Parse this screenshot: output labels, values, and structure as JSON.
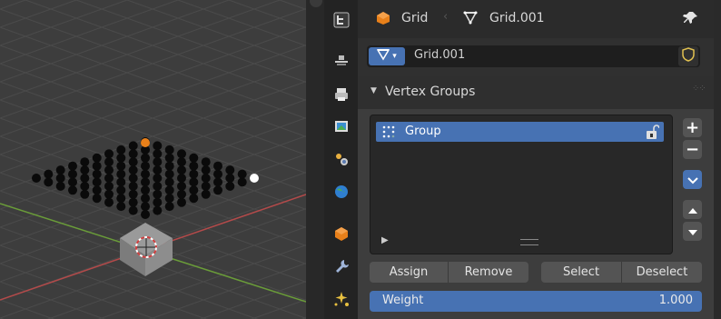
{
  "header": {
    "object_name": "Grid",
    "mesh_name": "Grid.001",
    "pin_icon": "pin-icon"
  },
  "mesh_datablock": {
    "value": "Grid.001",
    "data_icon": "mesh-data-icon",
    "fake_user_icon": "shield-icon"
  },
  "vertex_groups": {
    "title": "Vertex Groups",
    "items": [
      {
        "name": "Group",
        "locked": false
      }
    ],
    "buttons": {
      "assign": "Assign",
      "remove": "Remove",
      "select": "Select",
      "deselect": "Deselect"
    },
    "weight": {
      "label": "Weight",
      "value": "1.000"
    }
  },
  "tabs": [
    {
      "name": "tool",
      "icon": "tool-settings-icon",
      "active": false
    },
    {
      "name": "render",
      "icon": "render-icon",
      "active": false
    },
    {
      "name": "output",
      "icon": "printer-icon",
      "active": false
    },
    {
      "name": "view-layer",
      "icon": "image-icon",
      "active": false
    },
    {
      "name": "scene",
      "icon": "scene-icon",
      "active": false
    },
    {
      "name": "world",
      "icon": "world-icon",
      "active": false
    },
    {
      "name": "object",
      "icon": "object-icon",
      "active": false
    },
    {
      "name": "modifiers",
      "icon": "wrench-icon",
      "active": false
    },
    {
      "name": "particles",
      "icon": "particles-icon",
      "active": false
    }
  ],
  "colors": {
    "accent": "#4772b3",
    "object_orange": "#e8801a",
    "x_axis": "#b34a4a",
    "y_axis": "#6a9c39"
  }
}
